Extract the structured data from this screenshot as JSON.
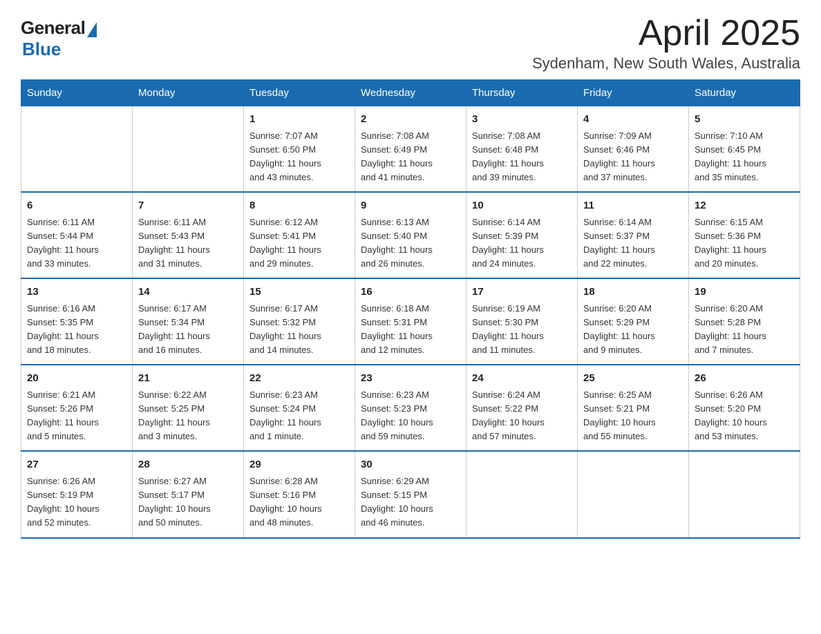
{
  "logo": {
    "general": "General",
    "blue": "Blue"
  },
  "title": "April 2025",
  "subtitle": "Sydenham, New South Wales, Australia",
  "days": [
    "Sunday",
    "Monday",
    "Tuesday",
    "Wednesday",
    "Thursday",
    "Friday",
    "Saturday"
  ],
  "weeks": [
    [
      {
        "day": "",
        "info": ""
      },
      {
        "day": "",
        "info": ""
      },
      {
        "day": "1",
        "info": "Sunrise: 7:07 AM\nSunset: 6:50 PM\nDaylight: 11 hours\nand 43 minutes."
      },
      {
        "day": "2",
        "info": "Sunrise: 7:08 AM\nSunset: 6:49 PM\nDaylight: 11 hours\nand 41 minutes."
      },
      {
        "day": "3",
        "info": "Sunrise: 7:08 AM\nSunset: 6:48 PM\nDaylight: 11 hours\nand 39 minutes."
      },
      {
        "day": "4",
        "info": "Sunrise: 7:09 AM\nSunset: 6:46 PM\nDaylight: 11 hours\nand 37 minutes."
      },
      {
        "day": "5",
        "info": "Sunrise: 7:10 AM\nSunset: 6:45 PM\nDaylight: 11 hours\nand 35 minutes."
      }
    ],
    [
      {
        "day": "6",
        "info": "Sunrise: 6:11 AM\nSunset: 5:44 PM\nDaylight: 11 hours\nand 33 minutes."
      },
      {
        "day": "7",
        "info": "Sunrise: 6:11 AM\nSunset: 5:43 PM\nDaylight: 11 hours\nand 31 minutes."
      },
      {
        "day": "8",
        "info": "Sunrise: 6:12 AM\nSunset: 5:41 PM\nDaylight: 11 hours\nand 29 minutes."
      },
      {
        "day": "9",
        "info": "Sunrise: 6:13 AM\nSunset: 5:40 PM\nDaylight: 11 hours\nand 26 minutes."
      },
      {
        "day": "10",
        "info": "Sunrise: 6:14 AM\nSunset: 5:39 PM\nDaylight: 11 hours\nand 24 minutes."
      },
      {
        "day": "11",
        "info": "Sunrise: 6:14 AM\nSunset: 5:37 PM\nDaylight: 11 hours\nand 22 minutes."
      },
      {
        "day": "12",
        "info": "Sunrise: 6:15 AM\nSunset: 5:36 PM\nDaylight: 11 hours\nand 20 minutes."
      }
    ],
    [
      {
        "day": "13",
        "info": "Sunrise: 6:16 AM\nSunset: 5:35 PM\nDaylight: 11 hours\nand 18 minutes."
      },
      {
        "day": "14",
        "info": "Sunrise: 6:17 AM\nSunset: 5:34 PM\nDaylight: 11 hours\nand 16 minutes."
      },
      {
        "day": "15",
        "info": "Sunrise: 6:17 AM\nSunset: 5:32 PM\nDaylight: 11 hours\nand 14 minutes."
      },
      {
        "day": "16",
        "info": "Sunrise: 6:18 AM\nSunset: 5:31 PM\nDaylight: 11 hours\nand 12 minutes."
      },
      {
        "day": "17",
        "info": "Sunrise: 6:19 AM\nSunset: 5:30 PM\nDaylight: 11 hours\nand 11 minutes."
      },
      {
        "day": "18",
        "info": "Sunrise: 6:20 AM\nSunset: 5:29 PM\nDaylight: 11 hours\nand 9 minutes."
      },
      {
        "day": "19",
        "info": "Sunrise: 6:20 AM\nSunset: 5:28 PM\nDaylight: 11 hours\nand 7 minutes."
      }
    ],
    [
      {
        "day": "20",
        "info": "Sunrise: 6:21 AM\nSunset: 5:26 PM\nDaylight: 11 hours\nand 5 minutes."
      },
      {
        "day": "21",
        "info": "Sunrise: 6:22 AM\nSunset: 5:25 PM\nDaylight: 11 hours\nand 3 minutes."
      },
      {
        "day": "22",
        "info": "Sunrise: 6:23 AM\nSunset: 5:24 PM\nDaylight: 11 hours\nand 1 minute."
      },
      {
        "day": "23",
        "info": "Sunrise: 6:23 AM\nSunset: 5:23 PM\nDaylight: 10 hours\nand 59 minutes."
      },
      {
        "day": "24",
        "info": "Sunrise: 6:24 AM\nSunset: 5:22 PM\nDaylight: 10 hours\nand 57 minutes."
      },
      {
        "day": "25",
        "info": "Sunrise: 6:25 AM\nSunset: 5:21 PM\nDaylight: 10 hours\nand 55 minutes."
      },
      {
        "day": "26",
        "info": "Sunrise: 6:26 AM\nSunset: 5:20 PM\nDaylight: 10 hours\nand 53 minutes."
      }
    ],
    [
      {
        "day": "27",
        "info": "Sunrise: 6:26 AM\nSunset: 5:19 PM\nDaylight: 10 hours\nand 52 minutes."
      },
      {
        "day": "28",
        "info": "Sunrise: 6:27 AM\nSunset: 5:17 PM\nDaylight: 10 hours\nand 50 minutes."
      },
      {
        "day": "29",
        "info": "Sunrise: 6:28 AM\nSunset: 5:16 PM\nDaylight: 10 hours\nand 48 minutes."
      },
      {
        "day": "30",
        "info": "Sunrise: 6:29 AM\nSunset: 5:15 PM\nDaylight: 10 hours\nand 46 minutes."
      },
      {
        "day": "",
        "info": ""
      },
      {
        "day": "",
        "info": ""
      },
      {
        "day": "",
        "info": ""
      }
    ]
  ]
}
